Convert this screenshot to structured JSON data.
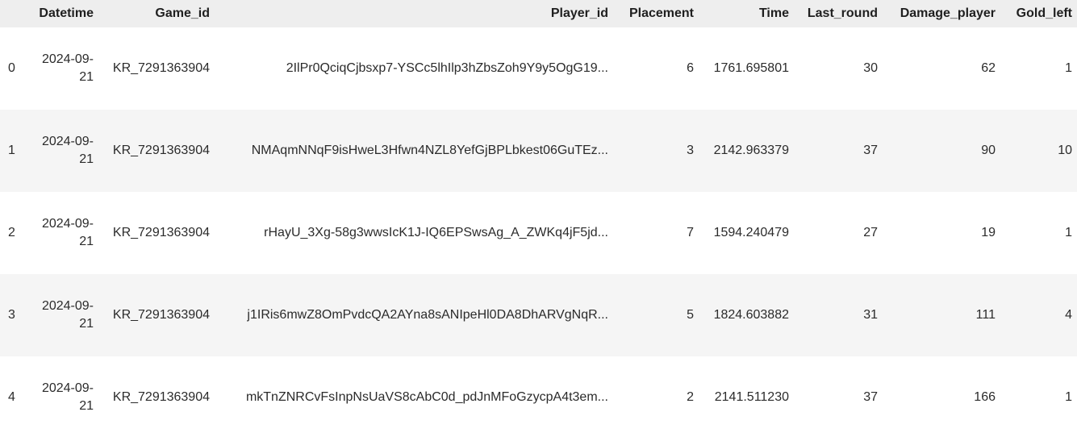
{
  "table": {
    "columns": [
      "",
      "Datetime",
      "Game_id",
      "Player_id",
      "Placement",
      "Time",
      "Last_round",
      "Damage_player",
      "Gold_left"
    ],
    "rows": [
      {
        "index": "0",
        "datetime_a": "2024-09-",
        "datetime_b": "21",
        "game_id": "KR_7291363904",
        "player_id": "2IlPr0QciqCjbsxp7-YSCc5lhIlp3hZbsZoh9Y9y5OgG19...",
        "placement": "6",
        "time": "1761.695801",
        "last_round": "30",
        "damage_player": "62",
        "gold_left": "1"
      },
      {
        "index": "1",
        "datetime_a": "2024-09-",
        "datetime_b": "21",
        "game_id": "KR_7291363904",
        "player_id": "NMAqmNNqF9isHweL3Hfwn4NZL8YefGjBPLbkest06GuTEz...",
        "placement": "3",
        "time": "2142.963379",
        "last_round": "37",
        "damage_player": "90",
        "gold_left": "10"
      },
      {
        "index": "2",
        "datetime_a": "2024-09-",
        "datetime_b": "21",
        "game_id": "KR_7291363904",
        "player_id": "rHayU_3Xg-58g3wwsIcK1J-IQ6EPSwsAg_A_ZWKq4jF5jd...",
        "placement": "7",
        "time": "1594.240479",
        "last_round": "27",
        "damage_player": "19",
        "gold_left": "1"
      },
      {
        "index": "3",
        "datetime_a": "2024-09-",
        "datetime_b": "21",
        "game_id": "KR_7291363904",
        "player_id": "j1IRis6mwZ8OmPvdcQA2AYna8sANIpeHl0DA8DhARVgNqR...",
        "placement": "5",
        "time": "1824.603882",
        "last_round": "31",
        "damage_player": "111",
        "gold_left": "4"
      },
      {
        "index": "4",
        "datetime_a": "2024-09-",
        "datetime_b": "21",
        "game_id": "KR_7291363904",
        "player_id": "mkTnZNRCvFsInpNsUaVS8cAbC0d_pdJnMFoGzycpA4t3em...",
        "placement": "2",
        "time": "2141.511230",
        "last_round": "37",
        "damage_player": "166",
        "gold_left": "1"
      }
    ]
  }
}
